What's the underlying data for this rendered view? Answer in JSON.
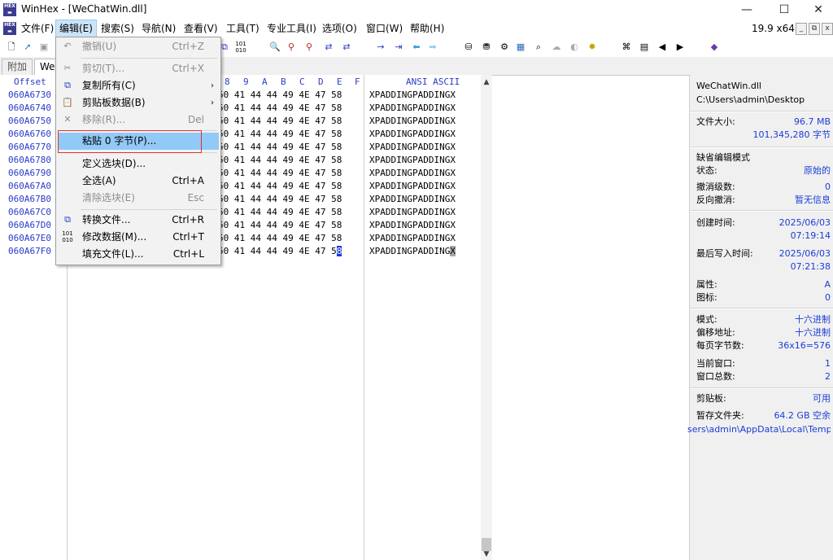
{
  "window": {
    "app_name": "WinHex",
    "title": "WinHex - [WeChatWin.dll]",
    "minimize": "—",
    "maximize": "☐",
    "close": "✕",
    "version": "19.9 x64",
    "mdi_buttons": [
      "_",
      "⧉",
      "x"
    ]
  },
  "menubar": {
    "items": [
      "文件(F)",
      "编辑(E)",
      "搜索(S)",
      "导航(N)",
      "查看(V)",
      "工具(T)",
      "专业工具(I)",
      "选项(O)",
      "窗口(W)",
      "帮助(H)"
    ]
  },
  "tabs": [
    "附加",
    "We"
  ],
  "hex_header": {
    "offset": "Offset",
    "columns": [
      "8",
      "9",
      "A",
      "B",
      "C",
      "D",
      "E",
      "F"
    ],
    "ascii": "ANSI ASCII"
  },
  "rows": [
    {
      "offset": "060A6730",
      "hex": "50 41 44 44 49 4E 47 58",
      "ascii": "XPADDINGPADDINGX"
    },
    {
      "offset": "060A6740",
      "hex": "50 41 44 44 49 4E 47 58",
      "ascii": "XPADDINGPADDINGX"
    },
    {
      "offset": "060A6750",
      "hex": "50 41 44 44 49 4E 47 58",
      "ascii": "XPADDINGPADDINGX"
    },
    {
      "offset": "060A6760",
      "hex": "50 41 44 44 49 4E 47 58",
      "ascii": "XPADDINGPADDINGX"
    },
    {
      "offset": "060A6770",
      "hex": "50 41 44 44 49 4E 47 58",
      "ascii": "XPADDINGPADDINGX"
    },
    {
      "offset": "060A6780",
      "hex": "50 41 44 44 49 4E 47 58",
      "ascii": "XPADDINGPADDINGX"
    },
    {
      "offset": "060A6790",
      "hex": "50 41 44 44 49 4E 47 58",
      "ascii": "XPADDINGPADDINGX"
    },
    {
      "offset": "060A67A0",
      "hex": "50 41 44 44 49 4E 47 58",
      "ascii": "XPADDINGPADDINGX"
    },
    {
      "offset": "060A67B0",
      "hex": "50 41 44 44 49 4E 47 58",
      "ascii": "XPADDINGPADDINGX"
    },
    {
      "offset": "060A67C0",
      "hex": "50 41 44 44 49 4E 47 58",
      "ascii": "XPADDINGPADDINGX"
    },
    {
      "offset": "060A67D0",
      "hex": "50 41 44 44 49 4E 47 58",
      "ascii": "XPADDINGPADDINGX"
    },
    {
      "offset": "060A67E0",
      "hex": "50 41 44 44 49 4E 47 58",
      "ascii": "XPADDINGPADDINGX"
    },
    {
      "offset": "060A67F0",
      "hex": "50 41 44 44 49 4E 47 58",
      "ascii": "XPADDINGPADDINGX"
    }
  ],
  "cursor": {
    "hex_last_digit": "8",
    "ascii_last_char": "X"
  },
  "edit_menu": [
    {
      "label": "撤销(U)",
      "shortcut": "Ctrl+Z",
      "disabled": true,
      "icon": "undo-icon"
    },
    {
      "label": "剪切(T)...",
      "shortcut": "Ctrl+X",
      "disabled": true,
      "icon": "cut-icon"
    },
    {
      "label": "复制所有(C)",
      "shortcut": "",
      "submenu": "›",
      "disabled": false,
      "icon": "copy-icon"
    },
    {
      "label": "剪贴板数据(B)",
      "shortcut": "",
      "submenu": "›",
      "disabled": false,
      "icon": "clipboard-icon"
    },
    {
      "label": "移除(R)...",
      "shortcut": "Del",
      "disabled": true,
      "icon": "remove-icon"
    },
    {
      "label": "粘贴 0 字节(P)...",
      "shortcut": "",
      "disabled": false,
      "highlighted": true
    },
    {
      "label": "定义选块(D)...",
      "shortcut": "",
      "disabled": false
    },
    {
      "label": "全选(A)",
      "shortcut": "Ctrl+A",
      "disabled": false
    },
    {
      "label": "清除选块(E)",
      "shortcut": "Esc",
      "disabled": true
    },
    {
      "label": "转换文件...",
      "shortcut": "Ctrl+R",
      "disabled": false,
      "icon": "convert-icon"
    },
    {
      "label": "修改数据(M)...",
      "shortcut": "Ctrl+T",
      "disabled": false,
      "icon": "binary-icon"
    },
    {
      "label": "填充文件(L)...",
      "shortcut": "Ctrl+L",
      "disabled": false
    }
  ],
  "info": {
    "filename": "WeChatWin.dll",
    "path": "C:\\Users\\admin\\Desktop",
    "filesize_label": "文件大小:",
    "filesize_mb": "96.7 MB",
    "filesize_bytes": "101,345,280 字节",
    "edit_mode_label": "缺省编辑模式",
    "state_label": "状态:",
    "state_value": "原始的",
    "undo_level_label": "撤消级数:",
    "undo_level_value": "0",
    "reverse_undo_label": "反向撤消:",
    "reverse_undo_value": "暂无信息",
    "created_label": "创建时间:",
    "created_date": "2025/06/03",
    "created_time": "07:19:14",
    "modified_label": "最后写入时间:",
    "modified_date": "2025/06/03",
    "modified_time": "07:21:38",
    "attr_label": "属性:",
    "attr_value": "A",
    "icon_label": "图标:",
    "icon_value": "0",
    "mode_label": "模式:",
    "mode_value": "十六进制",
    "offset_label": "偏移地址:",
    "offset_value": "十六进制",
    "bytes_per_page_label": "每页字节数:",
    "bytes_per_page_value": "36x16=576",
    "current_window_label": "当前窗口:",
    "current_window_value": "1",
    "total_windows_label": "窗口总数:",
    "total_windows_value": "2",
    "clipboard_label": "剪贴板:",
    "clipboard_value": "可用",
    "temp_label": "暂存文件夹:",
    "temp_value": "64.2 GB 空余",
    "temp_path": "sers\\admin\\AppData\\Local\\Temp"
  },
  "colors": {
    "offset_blue": "#2a3bc8",
    "highlight": "#91c9f7",
    "red_box": "#e03030"
  }
}
